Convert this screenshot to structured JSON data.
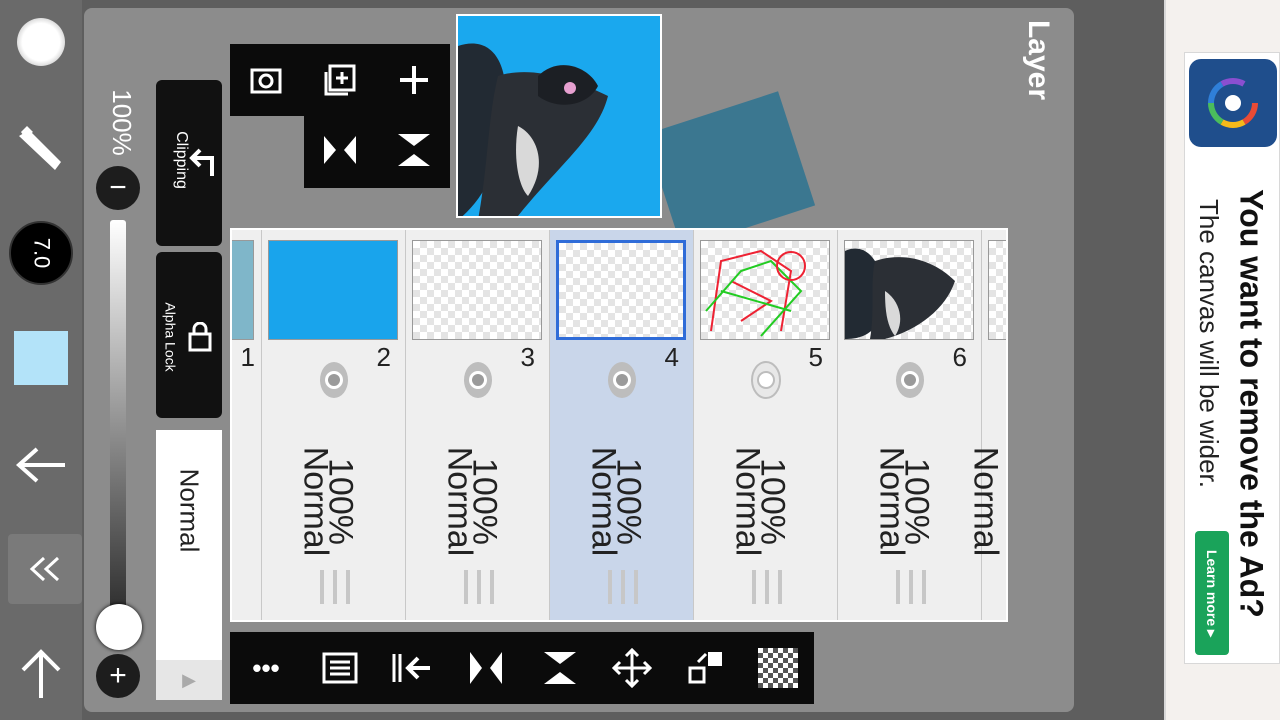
{
  "panel": {
    "title": "Layer"
  },
  "left_toolbar": {
    "brush_size": "7.0",
    "opacity": "100%",
    "icons": [
      "brush-dot-icon",
      "paintbrush-icon",
      "brush-size-icon",
      "color-swatch-icon",
      "back-arrow-icon",
      "collapse-icon",
      "up-arrow-icon"
    ],
    "swatch_color": "#b3e3f9"
  },
  "side_column": {
    "clipping_label": "Clipping",
    "alpha_lock_label": "Alpha Lock",
    "blend_mode": "Normal"
  },
  "opacity_slider": {
    "minus": "−",
    "plus": "+",
    "value_fraction": 1.0
  },
  "layers": [
    {
      "number": "1",
      "opacity": "",
      "blend": ""
    },
    {
      "number": "2",
      "opacity": "100%",
      "blend": "Normal",
      "fill": "#19a4ec"
    },
    {
      "number": "3",
      "opacity": "100%",
      "blend": "Normal"
    },
    {
      "number": "4",
      "opacity": "100%",
      "blend": "Normal",
      "selected": true
    },
    {
      "number": "5",
      "opacity": "100%",
      "blend": "Normal"
    },
    {
      "number": "6",
      "opacity": "100%",
      "blend": "Normal"
    },
    {
      "number": "",
      "opacity": "",
      "blend": "Normal"
    }
  ],
  "bottom_toolbar": {
    "icons": [
      "more-icon",
      "layer-props-icon",
      "merge-down-icon",
      "flip-horizontal-icon",
      "flip-vertical-icon",
      "move-icon",
      "transform-icon",
      "transparency-icon"
    ],
    "more_label": "•••"
  },
  "ad": {
    "headline": "You want to remove the Ad?",
    "body": "The canvas will be wider.",
    "cta": "Learn more ▸",
    "brand_colors": [
      "#e94b35",
      "#f6b91a",
      "#4bbd5c",
      "#2f7fd8",
      "#8a4fd0"
    ],
    "cta_color": "#1aa35a"
  }
}
